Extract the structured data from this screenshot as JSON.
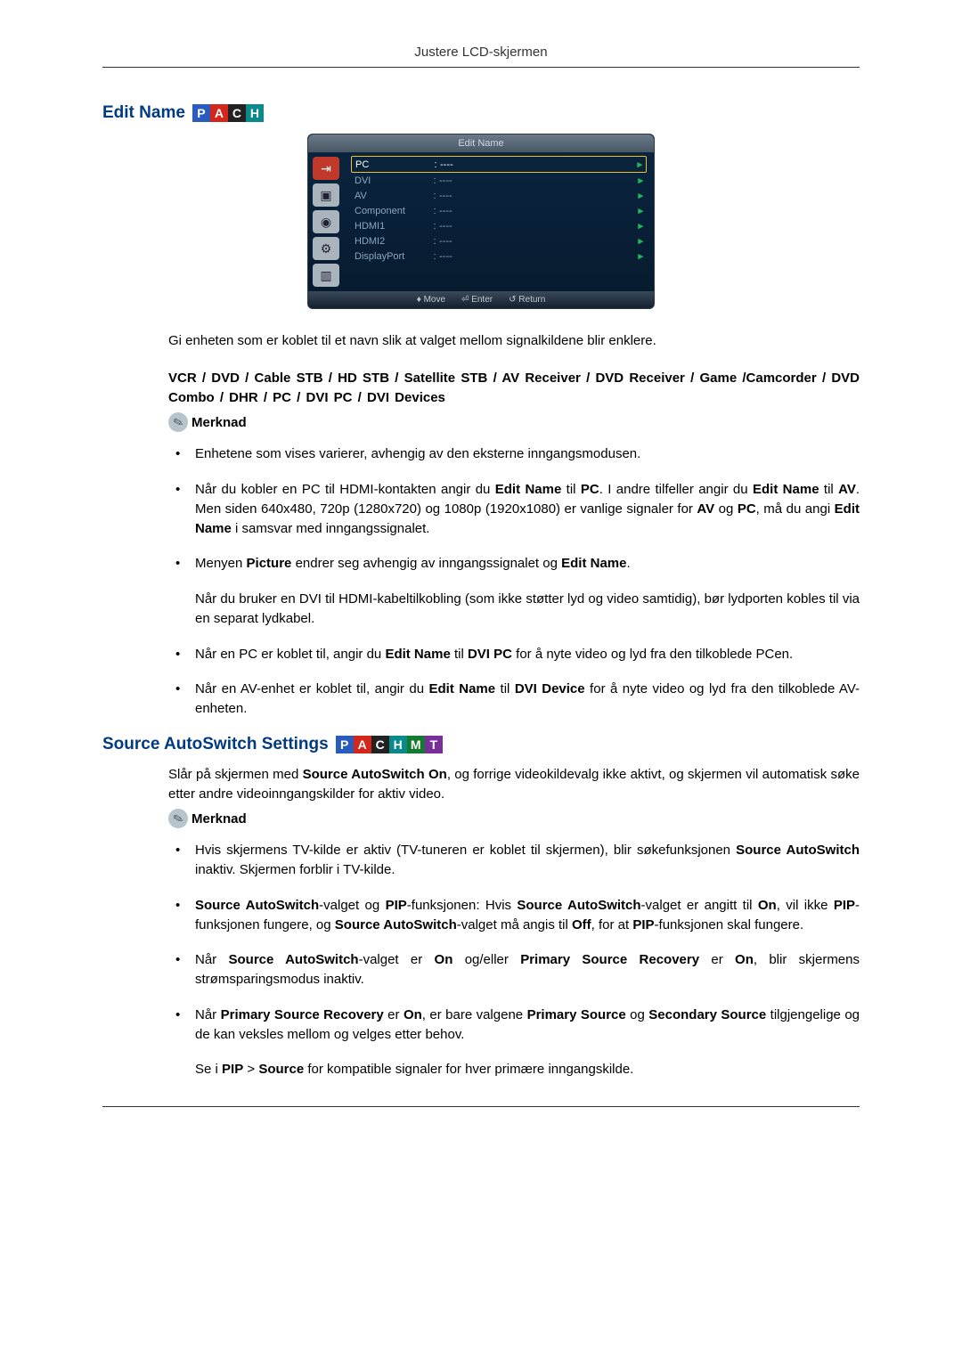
{
  "header": {
    "title": "Justere LCD-skjermen"
  },
  "badges": {
    "P": "P",
    "A": "A",
    "C": "C",
    "H": "H",
    "M": "M",
    "T": "T"
  },
  "section1": {
    "heading": "Edit Name",
    "osd": {
      "title": "Edit Name",
      "rows": [
        {
          "label": "PC",
          "value": "----",
          "selected": true
        },
        {
          "label": "DVI",
          "value": "----",
          "selected": false
        },
        {
          "label": "AV",
          "value": "----",
          "selected": false
        },
        {
          "label": "Component",
          "value": "----",
          "selected": false
        },
        {
          "label": "HDMI1",
          "value": "----",
          "selected": false
        },
        {
          "label": "HDMI2",
          "value": "----",
          "selected": false
        },
        {
          "label": "DisplayPort",
          "value": "----",
          "selected": false
        }
      ],
      "footer": {
        "move": "Move",
        "enter": "Enter",
        "return": "Return"
      }
    },
    "intro": "Gi enheten som er koblet til et navn slik at valget mellom signalkildene blir enklere.",
    "options": "VCR / DVD / Cable STB / HD STB / Satellite STB / AV Receiver / DVD Receiver / Game /Camcorder / DVD Combo / DHR / PC / DVI PC / DVI Devices",
    "note_label": "Merknad",
    "bullets": {
      "b1": "Enhetene som vises varierer, avhengig av den eksterne inngangsmodusen.",
      "b2_a": "Når du kobler en PC til HDMI-kontakten angir du ",
      "b2_b": "Edit Name",
      "b2_c": " til ",
      "b2_d": "PC",
      "b2_e": ". I andre tilfeller angir du ",
      "b2_f": "Edit Name",
      "b2_g": " til ",
      "b2_h": "AV",
      "b2_i": ". Men siden 640x480, 720p (1280x720) og 1080p (1920x1080) er vanlige signaler for ",
      "b2_j": "AV",
      "b2_k": " og ",
      "b2_l": "PC",
      "b2_m": ", må du angi ",
      "b2_n": "Edit Name",
      "b2_o": " i samsvar med inngangssignalet.",
      "b3_a": "Menyen ",
      "b3_b": "Picture",
      "b3_c": " endrer seg avhengig av inngangssignalet og ",
      "b3_d": "Edit Name",
      "b3_e": ".",
      "b3_sub": "Når du bruker en DVI til HDMI-kabeltilkobling (som ikke støtter lyd og video samtidig), bør lydporten kobles til via en separat lydkabel.",
      "b4_a": "Når en PC er koblet til, angir du ",
      "b4_b": "Edit Name",
      "b4_c": " til ",
      "b4_d": "DVI PC",
      "b4_e": " for å nyte video og lyd fra den tilkoblede PCen.",
      "b5_a": "Når en AV-enhet er koblet til, angir du ",
      "b5_b": "Edit Name",
      "b5_c": " til ",
      "b5_d": "DVI Device",
      "b5_e": " for å nyte video og lyd fra den tilkoblede AV-enheten."
    }
  },
  "section2": {
    "heading": "Source AutoSwitch Settings",
    "intro_a": "Slår på skjermen med ",
    "intro_b": "Source AutoSwitch On",
    "intro_c": ", og forrige videokildevalg ikke aktivt, og skjermen vil automatisk søke etter andre videoinngangskilder for aktiv video.",
    "note_label": "Merknad",
    "bullets": {
      "b1_a": "Hvis skjermens TV-kilde er aktiv (TV-tuneren er koblet til skjermen), blir søkefunksjonen ",
      "b1_b": "Source AutoSwitch",
      "b1_c": " inaktiv. Skjermen forblir i TV-kilde.",
      "b2_a": "Source AutoSwitch",
      "b2_b": "-valget og ",
      "b2_c": "PIP",
      "b2_d": "-funksjonen: Hvis ",
      "b2_e": "Source AutoSwitch",
      "b2_f": "-valget er angitt til ",
      "b2_g": "On",
      "b2_h": ", vil ikke ",
      "b2_i": "PIP",
      "b2_j": "-funksjonen fungere, og ",
      "b2_k": "Source AutoSwitch",
      "b2_l": "-valget må angis til ",
      "b2_m": "Off",
      "b2_n": ", for at ",
      "b2_o": "PIP",
      "b2_p": "-funksjonen skal fungere.",
      "b3_a": "Når ",
      "b3_b": "Source AutoSwitch",
      "b3_c": "-valget er ",
      "b3_d": "On",
      "b3_e": " og/eller ",
      "b3_f": "Primary Source Recovery",
      "b3_g": " er ",
      "b3_h": "On",
      "b3_i": ", blir skjermens strømsparingsmodus inaktiv.",
      "b4_a": "Når ",
      "b4_b": "Primary Source Recovery",
      "b4_c": " er ",
      "b4_d": "On",
      "b4_e": ", er bare valgene ",
      "b4_f": "Primary Source",
      "b4_g": " og ",
      "b4_h": "Secondary Source",
      "b4_i": " tilgjengelige og de kan veksles mellom og velges etter behov.",
      "b4_sub_a": "Se i ",
      "b4_sub_b": "PIP",
      "b4_sub_c": " > ",
      "b4_sub_d": "Source",
      "b4_sub_e": " for kompatible signaler for hver primære inngangskilde."
    }
  }
}
